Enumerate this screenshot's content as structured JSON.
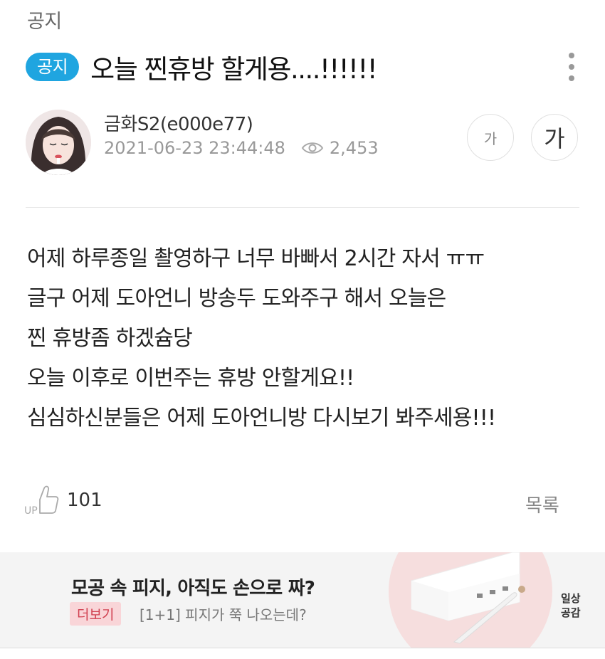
{
  "board": {
    "name": "공지"
  },
  "post": {
    "badge": "공지",
    "title": "오늘 찐휴방 할게용....!!!!!!",
    "author": "금화S2(e000e77)",
    "datetime": "2021-06-23 23:44:48",
    "views": "2,453",
    "font_small_label": "가",
    "font_large_label": "가",
    "content_lines": [
      "어제 하루종일 촬영하구 너무 바빠서 2시간 자서 ㅠㅠ",
      "글구 어제 도아언니 방송두 도와주구 해서 오늘은",
      "찐 휴방좀 하겠슘당",
      "오늘 이후로 이번주는 휴방 안할게요!!",
      "심심하신분들은 어제 도아언니방 다시보기 봐주세용!!!"
    ],
    "up_count": "101",
    "list_label": "목록"
  },
  "ad": {
    "headline": "모공 속 피지, 아직도 손으로 짜?",
    "more_label": "더보기",
    "sub_text": "[1+1] 피지가 쭉 나오는데?",
    "brand_logo": "일상공감"
  },
  "icons": {
    "more": "more-vertical-icon",
    "views": "eye-icon",
    "up": "thumbs-up-icon"
  },
  "colors": {
    "badge": "#1fa5e0",
    "ad_more_bg": "#f9d5d8",
    "ad_more_text": "#d14050"
  }
}
